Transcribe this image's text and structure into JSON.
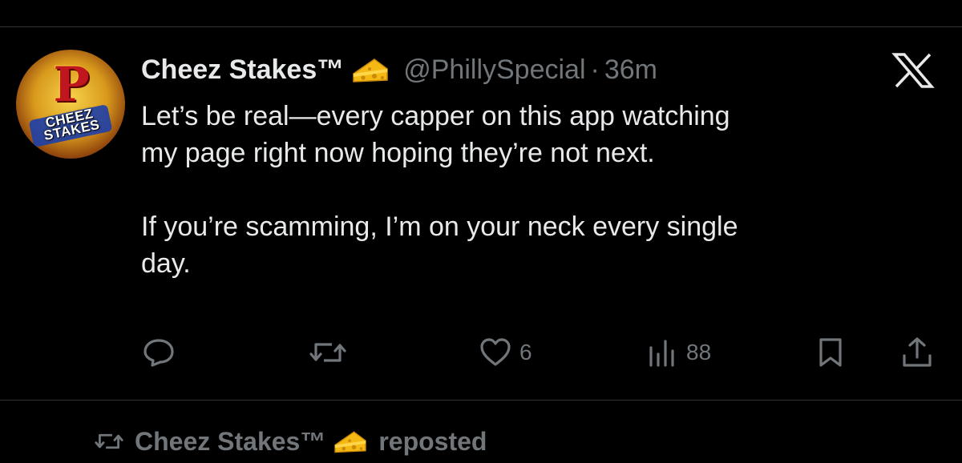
{
  "tweet": {
    "display_name": "Cheez Stakes™",
    "handle": "@PhillySpecial",
    "separator": "·",
    "time": "36m",
    "text": "Let’s be real—every capper on this app watching\nmy page right now hoping they’re not next.\n\nIf you’re scamming, I’m on your neck every single\nday.",
    "avatar": {
      "letter": "P",
      "badge_line1": "CHEEZ",
      "badge_line2": "STAKES"
    },
    "actions": {
      "reply_count": "",
      "repost_count": "",
      "like_count": "6",
      "views_count": "88"
    }
  },
  "repost_banner": {
    "name": "Cheez Stakes™",
    "label": "reposted"
  },
  "colors": {
    "background": "#000000",
    "text": "#e7e9ea",
    "secondary": "#71767b",
    "divider": "#2f3336",
    "cheese": "#f5b914"
  },
  "icons": [
    "cheese-emoji",
    "x-logo",
    "reply-icon",
    "repost-icon",
    "like-icon",
    "views-icon",
    "bookmark-icon",
    "share-icon"
  ]
}
